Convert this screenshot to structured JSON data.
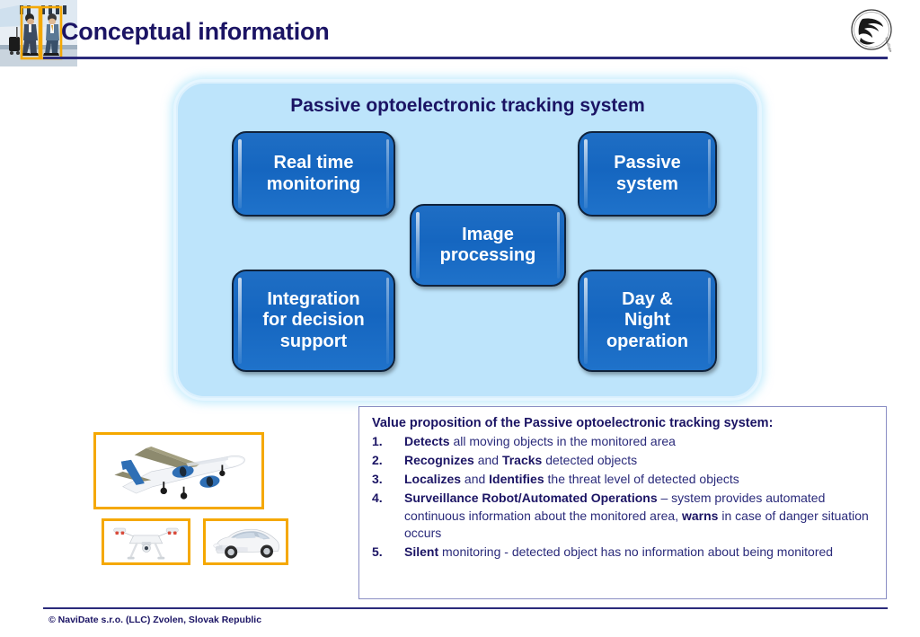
{
  "header": {
    "title": "Conceptual information",
    "logo_icon": "navidate-bird-circle-logo"
  },
  "diagram": {
    "panel_title": "Passive optoelectronic tracking system",
    "boxes": [
      {
        "id": "realtime",
        "label": "Real time\nmonitoring"
      },
      {
        "id": "passive",
        "label": "Passive\nsystem"
      },
      {
        "id": "image",
        "label": "Image\nprocessing"
      },
      {
        "id": "integration",
        "label": "Integration\nfor decision\nsupport"
      },
      {
        "id": "daynight",
        "label": "Day &\nNight\noperation"
      }
    ]
  },
  "value_proposition": {
    "title": "Value proposition of the Passive optoelectronic tracking system:",
    "items": [
      {
        "num": "1.",
        "html": "<b>Detects</b> all moving objects in the monitored area"
      },
      {
        "num": "2.",
        "html": "<b>Recognizes</b> and <b>Tracks</b> detected objects"
      },
      {
        "num": "3.",
        "html": "<b>Localizes</b> and <b>Identifies</b> the threat level of detected objects"
      },
      {
        "num": "4.",
        "html": "<b>Surveillance Robot/Automated Operations</b> – system provides automated continuous information about the monitored area, <b>warns</b> in case of danger situation occurs"
      },
      {
        "num": "5.",
        "html": "<b>Silent</b> monitoring - detected object has no information about being monitored"
      }
    ]
  },
  "detection_images": [
    {
      "id": "plane",
      "icon": "airplane-photo",
      "bbox_color": "#f5a800"
    },
    {
      "id": "people",
      "icon": "pedestrians-photo",
      "bbox_color": "#f5a800"
    },
    {
      "id": "drone",
      "icon": "quadcopter-drone-photo",
      "bbox_color": "#f5a800"
    },
    {
      "id": "car",
      "icon": "white-sedan-car-photo",
      "bbox_color": "#f5a800"
    }
  ],
  "footer": {
    "copyright": "© NaviDate s.r.o. (LLC) Zvolen, Slovak Republic"
  },
  "colors": {
    "title_navy": "#1b1464",
    "rule_navy": "#2a2a7a",
    "panel_blue": "#bde4fb",
    "box_blue": "#1566c0",
    "bbox_orange": "#f5a800"
  }
}
